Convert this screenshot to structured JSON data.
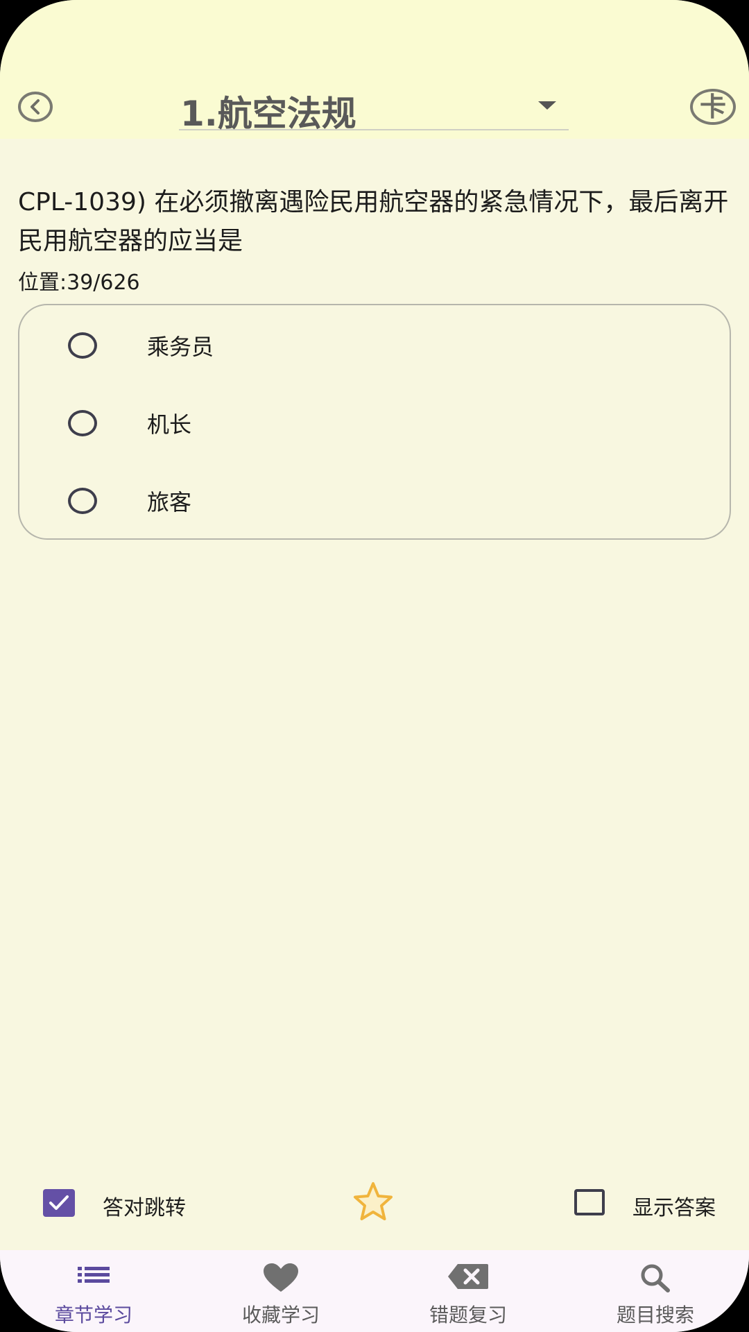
{
  "header": {
    "chapter_title": "1.航空法规",
    "card_button_label": "卡"
  },
  "question": {
    "text": "CPL-1039) 在必须撤离遇险民用航空器的紧急情况下，最后离开民用航空器的应当是",
    "position": "位置:39/626"
  },
  "options": [
    {
      "label": "乘务员",
      "selected": false
    },
    {
      "label": "机长",
      "selected": false
    },
    {
      "label": "旅客",
      "selected": false
    }
  ],
  "controls": {
    "auto_jump_label": "答对跳转",
    "auto_jump_checked": true,
    "show_answer_label": "显示答案",
    "show_answer_checked": false,
    "favorite_starred": false
  },
  "bottom_nav": {
    "active_index": 0,
    "items": [
      {
        "label": "章节学习",
        "icon": "list-icon"
      },
      {
        "label": "收藏学习",
        "icon": "heart-icon"
      },
      {
        "label": "错题复习",
        "icon": "backspace-icon"
      },
      {
        "label": "题目搜索",
        "icon": "search-icon"
      }
    ]
  },
  "colors": {
    "background": "#f8f7e0",
    "header_background": "#fafbd2",
    "accent": "#6450a6",
    "star": "#f0b43c",
    "nav_background": "#fbf5fb"
  }
}
